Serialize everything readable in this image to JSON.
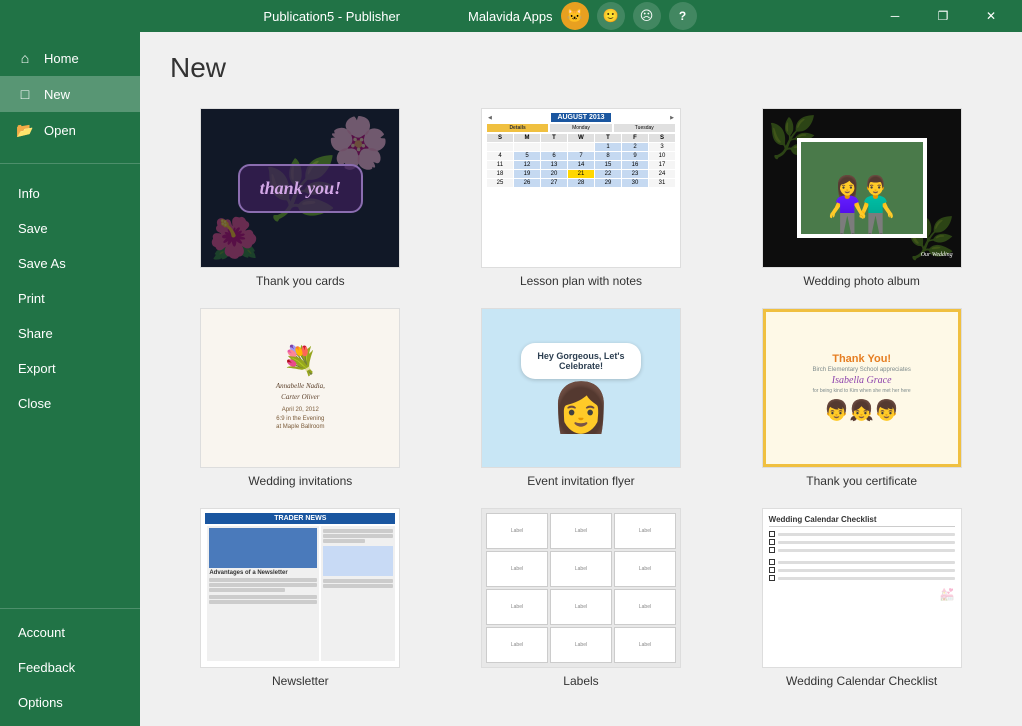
{
  "titlebar": {
    "title": "Publication5 - Publisher",
    "apps_label": "Malavida Apps",
    "emoji_smiley": "🙂",
    "emoji_sad": "☹",
    "btn_minimize": "─",
    "btn_restore": "❐",
    "btn_close": "✕",
    "btn_help": "?"
  },
  "sidebar": {
    "top_items": [
      {
        "id": "home",
        "label": "Home",
        "icon": "⌂"
      },
      {
        "id": "new",
        "label": "New",
        "icon": "□",
        "active": true
      },
      {
        "id": "open",
        "label": "Open",
        "icon": "📂"
      }
    ],
    "mid_items": [
      {
        "id": "info",
        "label": "Info"
      },
      {
        "id": "save",
        "label": "Save"
      },
      {
        "id": "save-as",
        "label": "Save As"
      },
      {
        "id": "print",
        "label": "Print"
      },
      {
        "id": "share",
        "label": "Share"
      },
      {
        "id": "export",
        "label": "Export"
      },
      {
        "id": "close",
        "label": "Close"
      }
    ],
    "bottom_items": [
      {
        "id": "account",
        "label": "Account"
      },
      {
        "id": "feedback",
        "label": "Feedback"
      },
      {
        "id": "options",
        "label": "Options"
      }
    ]
  },
  "main": {
    "title": "New",
    "templates": [
      {
        "id": "thank-you-cards",
        "label": "Thank you cards"
      },
      {
        "id": "lesson-plan",
        "label": "Lesson plan with notes"
      },
      {
        "id": "wedding-album",
        "label": "Wedding photo album"
      },
      {
        "id": "wedding-invitations",
        "label": "Wedding invitations"
      },
      {
        "id": "event-flyer",
        "label": "Event invitation flyer"
      },
      {
        "id": "thank-you-cert",
        "label": "Thank you certificate"
      },
      {
        "id": "newsletter",
        "label": "Newsletter"
      },
      {
        "id": "labels",
        "label": "Labels"
      },
      {
        "id": "checklist",
        "label": "Wedding Calendar Checklist"
      }
    ],
    "calendar": {
      "month": "AUGUST 2013",
      "days": [
        "S",
        "M",
        "T",
        "W",
        "T",
        "F",
        "S"
      ],
      "cells": [
        "",
        "",
        "",
        "",
        "1",
        "2",
        "3",
        "4",
        "5",
        "6",
        "7",
        "8",
        "9",
        "10",
        "11",
        "12",
        "13",
        "14",
        "15",
        "16",
        "17",
        "18",
        "19",
        "20",
        "21",
        "22",
        "23",
        "24",
        "25",
        "26",
        "27",
        "28",
        "29",
        "30",
        "31",
        "",
        ""
      ]
    },
    "wedding_caption": "Our Wedding",
    "event_bubble": "Hey Gorgeous, Let's Celebrate!",
    "cert_title": "Thank You!",
    "cert_org": "Birch Elementary School appreciates",
    "cert_name": "Isabella Grace",
    "cert_reason": "for being kind to Kim when she met her here",
    "newsletter_header": "TRADER NEWS",
    "newsletter_subhead": "Advantages of a Newsletter",
    "inv_name1": "Annabelle Nadia,",
    "inv_name2": "Carter Oliver"
  }
}
